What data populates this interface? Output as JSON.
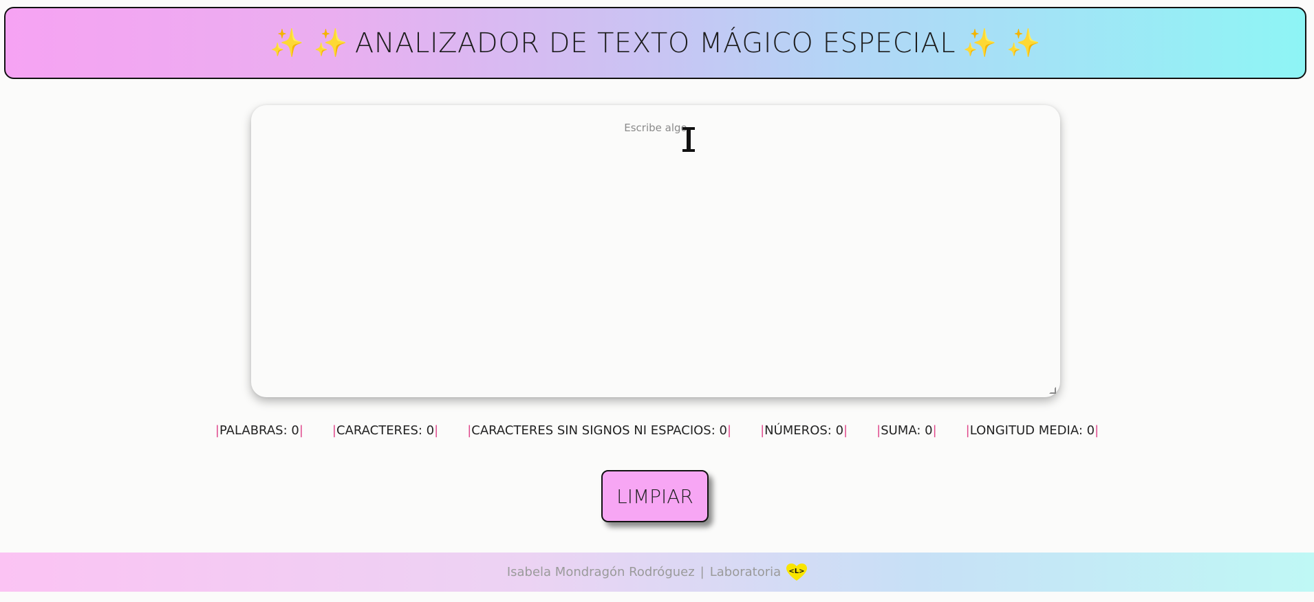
{
  "header": {
    "sparkle_left": "✨ ✨",
    "title": "ANALIZADOR DE TEXTO MÁGICO ESPECIAL",
    "sparkle_right": "✨ ✨"
  },
  "input": {
    "placeholder": "Escribe algo",
    "value": ""
  },
  "stats": [
    {
      "label": "PALABRAS: 0"
    },
    {
      "label": "CARACTERES: 0"
    },
    {
      "label": "CARACTERES SIN SIGNOS NI ESPACIOS: 0"
    },
    {
      "label": "NÚMEROS: 0"
    },
    {
      "label": "SUMA: 0"
    },
    {
      "label": "LONGITUD MEDIA: 0"
    }
  ],
  "clear_button": {
    "label": "LIMPIAR"
  },
  "footer": {
    "author": "Isabela Mondragón Rodróguez",
    "separator": "|",
    "org": "Laboratoria",
    "logo_text": "<L>",
    "logo_color": "#f9e500"
  },
  "colors": {
    "stat_bar": "#e0468a",
    "button_bg": "#f7a6f4",
    "sparkle": "#f3c440"
  }
}
